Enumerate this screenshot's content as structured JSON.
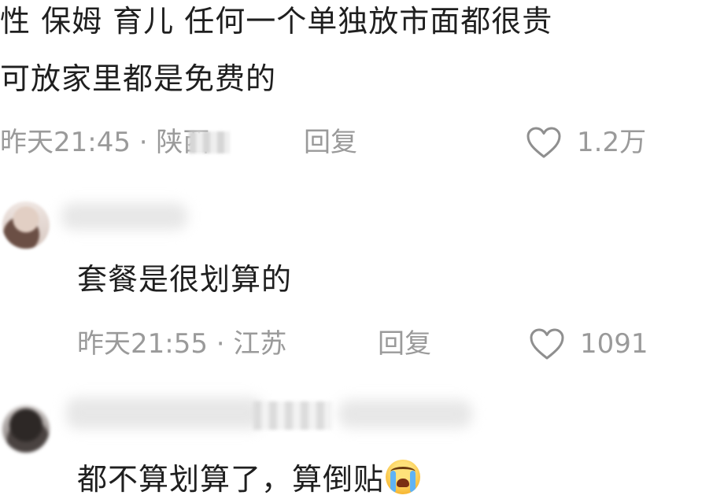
{
  "comment_1": {
    "text_line_1": "性  保姆  育儿  任何一个单独放市面都很贵",
    "text_line_2": "可放家里都是免费的",
    "time": "昨天21:45",
    "separator": "·",
    "location": "陕西",
    "reply_label": "回复",
    "likes": "1.2万"
  },
  "comment_2": {
    "text": "套餐是很划算的",
    "time": "昨天21:55",
    "separator": "·",
    "location": "江苏",
    "reply_label": "回复",
    "likes": "1091"
  },
  "comment_3": {
    "text": "都不算划算了，算倒贴",
    "emoji": "crying-face"
  },
  "colors": {
    "text": "#1f1f1f",
    "meta": "#9a9a9a",
    "background": "#ffffff"
  },
  "icons": {
    "like": "heart-outline-icon"
  }
}
